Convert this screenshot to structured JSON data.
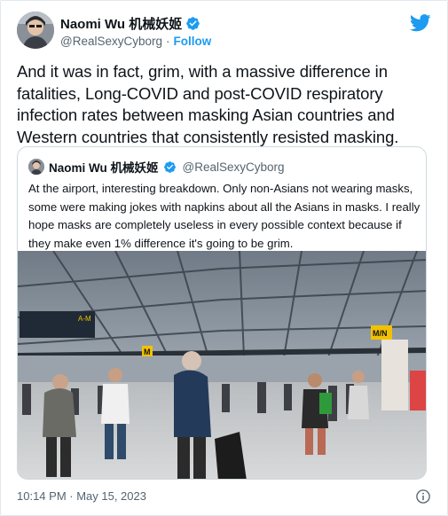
{
  "author": {
    "display_name": "Naomi Wu 机械妖姬",
    "handle": "@RealSexyCyborg",
    "separator": "·",
    "follow_label": "Follow"
  },
  "tweet": {
    "text": "And it was in fact, grim, with a massive difference in fatalities, Long-COVID and post-COVID respiratory infection rates between masking Asian countries and Western countries that consistently resisted masking.",
    "timestamp": "10:14 PM · May 15, 2023"
  },
  "quoted_tweet": {
    "display_name": "Naomi Wu 机械妖姬",
    "handle": "@RealSexyCyborg",
    "text": "At the airport, interesting breakdown. Only non-Asians not wearing masks, some were making jokes with napkins about all the Asians in masks. I really hope masks are completely useless in every possible context because if they make even 1% difference it's going to be grim.",
    "photo_signs": {
      "sign_left_top": "A-M",
      "sign_mn": "M/N",
      "sign_m": "M"
    }
  },
  "icons": {
    "verified": "verified-badge-icon",
    "brand": "twitter-bird-icon",
    "info": "info-icon"
  },
  "colors": {
    "accent": "#1d9bf0",
    "text": "#0f1419",
    "muted": "#536471",
    "border": "#cfd9de"
  }
}
